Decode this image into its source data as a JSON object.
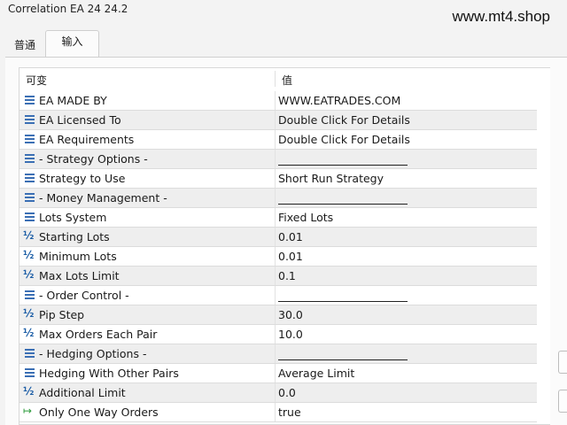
{
  "window": {
    "title": "Correlation EA 24 24.2"
  },
  "watermark": "www.mt4.shop",
  "tabs": [
    {
      "label": "普通",
      "active": false
    },
    {
      "label": "输入",
      "active": true
    }
  ],
  "table": {
    "headers": {
      "variable": "可变",
      "value": "值"
    },
    "rows": [
      {
        "icon": "list-icon",
        "name": "EA MADE BY",
        "value": "WWW.EATRADES.COM"
      },
      {
        "icon": "list-icon",
        "name": "EA Licensed To",
        "value": "Double Click For Details"
      },
      {
        "icon": "list-icon",
        "name": "EA Requirements",
        "value": "Double Click For Details"
      },
      {
        "icon": "list-icon",
        "name": "- Strategy Options -",
        "value": ""
      },
      {
        "icon": "list-icon",
        "name": "Strategy to Use",
        "value": "Short Run Strategy"
      },
      {
        "icon": "list-icon",
        "name": "- Money Management -",
        "value": ""
      },
      {
        "icon": "list-icon",
        "name": "Lots System",
        "value": "Fixed Lots"
      },
      {
        "icon": "half-icon",
        "name": "Starting Lots",
        "value": "0.01"
      },
      {
        "icon": "half-icon",
        "name": "Minimum Lots",
        "value": "0.01"
      },
      {
        "icon": "half-icon",
        "name": "Max Lots Limit",
        "value": "0.1"
      },
      {
        "icon": "list-icon",
        "name": "- Order Control -",
        "value": ""
      },
      {
        "icon": "half-icon",
        "name": "Pip Step",
        "value": "30.0"
      },
      {
        "icon": "half-icon",
        "name": "Max Orders Each Pair",
        "value": "10.0"
      },
      {
        "icon": "list-icon",
        "name": "- Hedging Options -",
        "value": ""
      },
      {
        "icon": "list-icon",
        "name": "Hedging With Other Pairs",
        "value": "Average Limit"
      },
      {
        "icon": "half-icon",
        "name": "Additional Limit",
        "value": "0.0"
      },
      {
        "icon": "arrow-icon",
        "name": "Only One Way Orders",
        "value": "true"
      }
    ]
  },
  "icons": {
    "half_glyph": "½",
    "arrow_glyph": "↦"
  },
  "colors": {
    "section_row": "#eeeeee",
    "icon_blue": "#3b6fb4",
    "icon_green": "#2e9b3c"
  }
}
